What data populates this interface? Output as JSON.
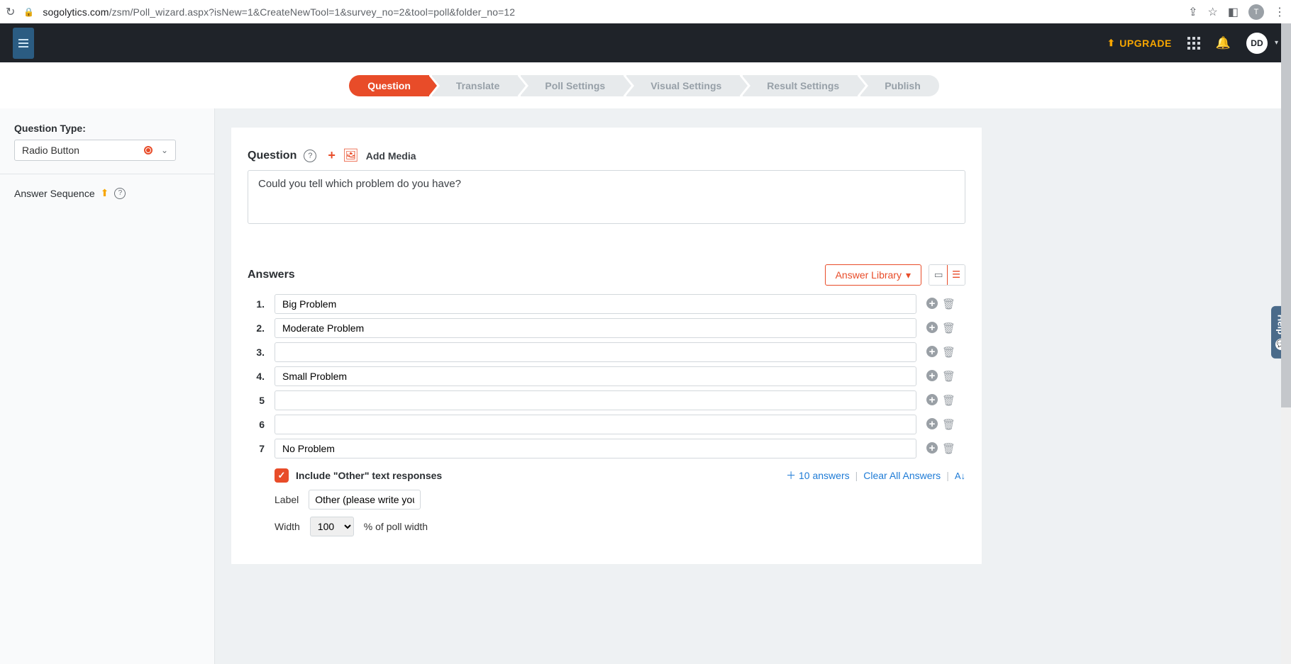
{
  "browser": {
    "url_host": "sogolytics.com",
    "url_path": "/zsm/Poll_wizard.aspx?isNew=1&CreateNewTool=1&survey_no=2&tool=poll&folder_no=12",
    "profile_initial": "T"
  },
  "header": {
    "upgrade": "UPGRADE",
    "avatar": "DD"
  },
  "wizard_steps": [
    "Question",
    "Translate",
    "Poll Settings",
    "Visual Settings",
    "Result Settings",
    "Publish"
  ],
  "sidebar": {
    "question_type_label": "Question Type:",
    "question_type_value": "Radio Button",
    "answer_sequence_label": "Answer Sequence"
  },
  "question": {
    "section_label": "Question",
    "add_media_label": "Add Media",
    "text": "Could you tell which problem do you have?"
  },
  "answers": {
    "section_label": "Answers",
    "library_button": "Answer Library",
    "rows": [
      {
        "num": "1.",
        "value": "Big Problem"
      },
      {
        "num": "2.",
        "value": "Moderate Problem"
      },
      {
        "num": "3.",
        "value": ""
      },
      {
        "num": "4.",
        "value": "Small Problem"
      },
      {
        "num": "5",
        "value": ""
      },
      {
        "num": "6",
        "value": ""
      },
      {
        "num": "7",
        "value": "No Problem"
      }
    ],
    "include_other_label": "Include \"Other\" text responses",
    "other_label_caption": "Label",
    "other_label_value": "Other (please write you",
    "width_caption": "Width",
    "width_value": "100",
    "width_suffix": "% of poll width",
    "add_ten": "10 answers",
    "clear_all": "Clear All Answers"
  },
  "help_tab": "Help"
}
